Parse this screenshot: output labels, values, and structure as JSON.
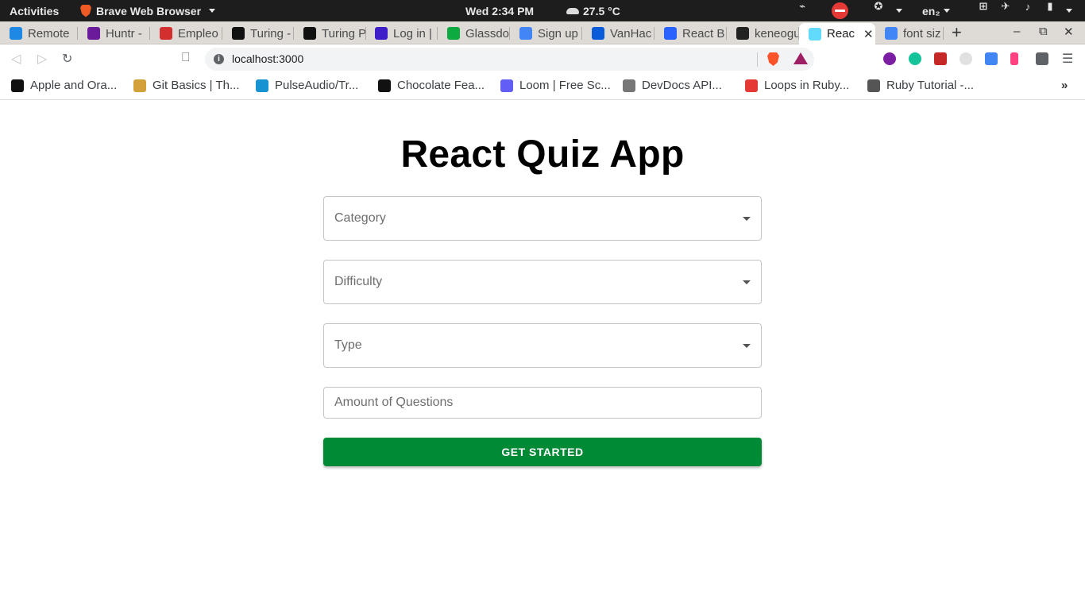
{
  "system_bar": {
    "activities": "Activities",
    "app_name": "Brave Web Browser",
    "clock": "Wed  2:34 PM",
    "weather": "27.5 °C",
    "language": "en₂"
  },
  "tabs": [
    {
      "label": "Remote",
      "favicon": "remote-icon",
      "color": "#1e88e5"
    },
    {
      "label": "Huntr -",
      "favicon": "huntr-icon",
      "color": "#6a1b9a"
    },
    {
      "label": "Empleo",
      "favicon": "megaphone-icon",
      "color": "#d32f2f"
    },
    {
      "label": "Turing -",
      "favicon": "turing-icon",
      "color": "#111111"
    },
    {
      "label": "Turing P",
      "favicon": "turing-icon",
      "color": "#111111"
    },
    {
      "label": "Log in |",
      "favicon": "login-icon",
      "color": "#3d1ec9"
    },
    {
      "label": "Glassdo",
      "favicon": "glassdoor-icon",
      "color": "#0caa41"
    },
    {
      "label": "Sign up",
      "favicon": "google-icon",
      "color": "#4285f4"
    },
    {
      "label": "VanHac",
      "favicon": "vanhack-icon",
      "color": "#0a5bd9"
    },
    {
      "label": "React B",
      "favicon": "react-b-icon",
      "color": "#2962ff"
    },
    {
      "label": "keneogu",
      "favicon": "github-icon",
      "color": "#222222"
    },
    {
      "label": "Reac",
      "favicon": "react-icon",
      "color": "#61dafb",
      "active": true
    },
    {
      "label": "font siz",
      "favicon": "google-icon",
      "color": "#4285f4"
    }
  ],
  "toolbar": {
    "url": "localhost:3000"
  },
  "bookmarks": [
    {
      "label": "Apple and Ora...",
      "favicon": "hb-icon",
      "color": "#111111"
    },
    {
      "label": "Git Basics | Th...",
      "favicon": "odin-icon",
      "color": "#d4a03a"
    },
    {
      "label": "PulseAudio/Tr...",
      "favicon": "arch-icon",
      "color": "#1793d1"
    },
    {
      "label": "Chocolate Fea...",
      "favicon": "hb-icon",
      "color": "#111111"
    },
    {
      "label": "Loom | Free Sc...",
      "favicon": "loom-icon",
      "color": "#625df5"
    },
    {
      "label": "DevDocs API...",
      "favicon": "devdocs-icon",
      "color": "#777777"
    },
    {
      "label": "Loops in Ruby...",
      "favicon": "ruby-stripes-icon",
      "color": "#e53935"
    },
    {
      "label": "Ruby Tutorial -...",
      "favicon": "diamond-icon",
      "color": "#555555"
    }
  ],
  "page": {
    "title": "React Quiz App",
    "category_label": "Category",
    "difficulty_label": "Difficulty",
    "type_label": "Type",
    "amount_placeholder": "Amount of Questions",
    "start_button": "GET STARTED"
  }
}
